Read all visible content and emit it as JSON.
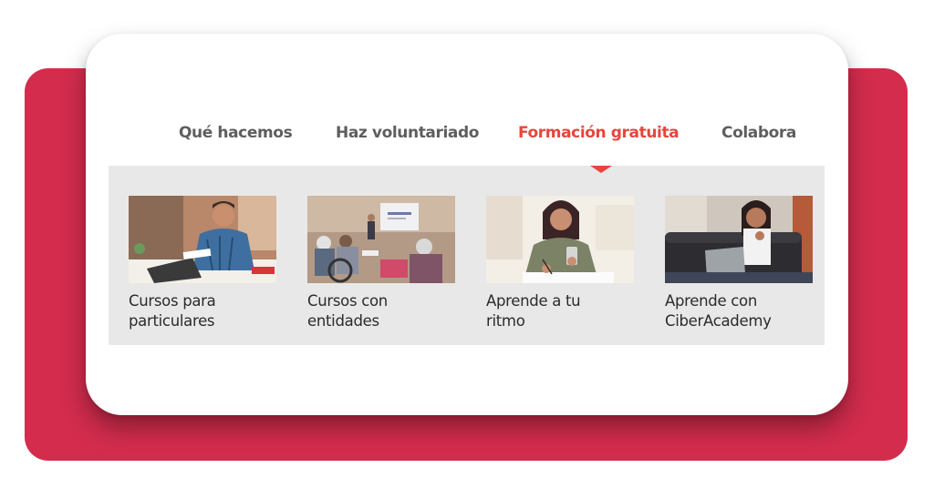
{
  "colors": {
    "brand_red": "#d32c4d",
    "accent_active": "#e8453c",
    "nav_text": "#5e5e5e",
    "panel_bg": "#e8e8e8"
  },
  "nav": {
    "items": [
      {
        "label": "Qué hacemos",
        "active": false
      },
      {
        "label": "Haz voluntariado",
        "active": false
      },
      {
        "label": "Formación gratuita",
        "active": true
      },
      {
        "label": "Colabora",
        "active": false
      }
    ]
  },
  "menu": {
    "tiles": [
      {
        "label": "Cursos para\nparticulares",
        "image": "man-laptop-photo"
      },
      {
        "label": "Cursos con\nentidades",
        "image": "classroom-seniors-photo"
      },
      {
        "label": "Aprende a tu\nritmo",
        "image": "woman-phone-notes-photo"
      },
      {
        "label": "Aprende con\nCiberAcademy",
        "image": "woman-sofa-laptop-photo"
      }
    ]
  }
}
